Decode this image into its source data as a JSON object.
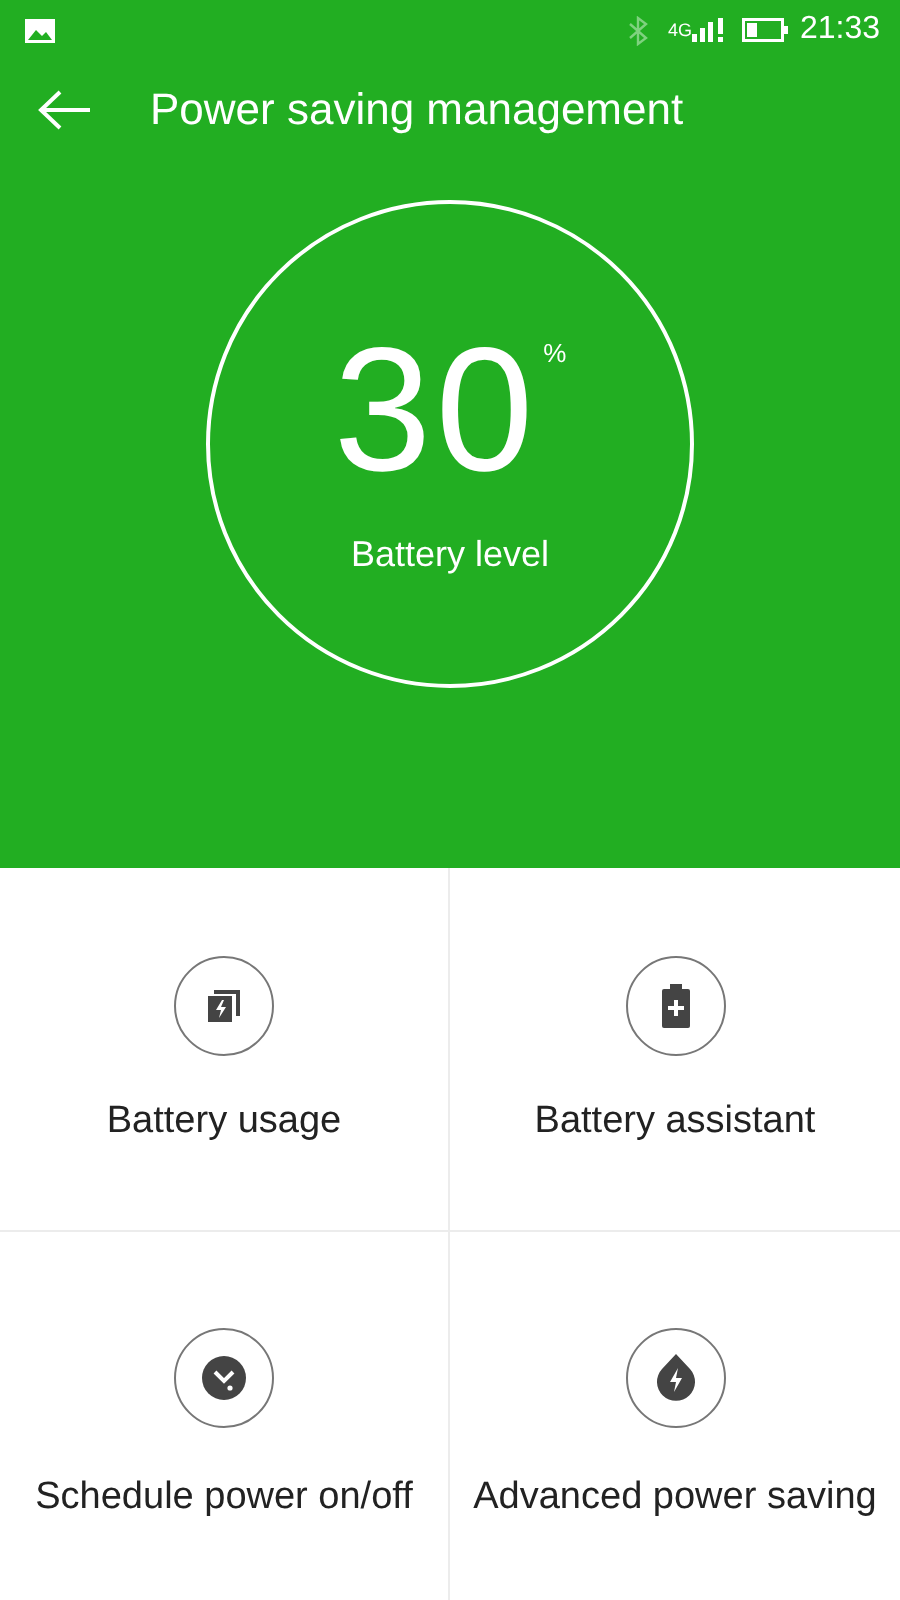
{
  "status_bar": {
    "network": "4G",
    "time": "21:33"
  },
  "header": {
    "title": "Power saving management"
  },
  "battery": {
    "value": "30",
    "unit": "%",
    "label": "Battery level"
  },
  "tiles": [
    {
      "label": "Battery usage"
    },
    {
      "label": "Battery assistant"
    },
    {
      "label": "Schedule power on/off"
    },
    {
      "label": "Advanced power saving"
    }
  ]
}
